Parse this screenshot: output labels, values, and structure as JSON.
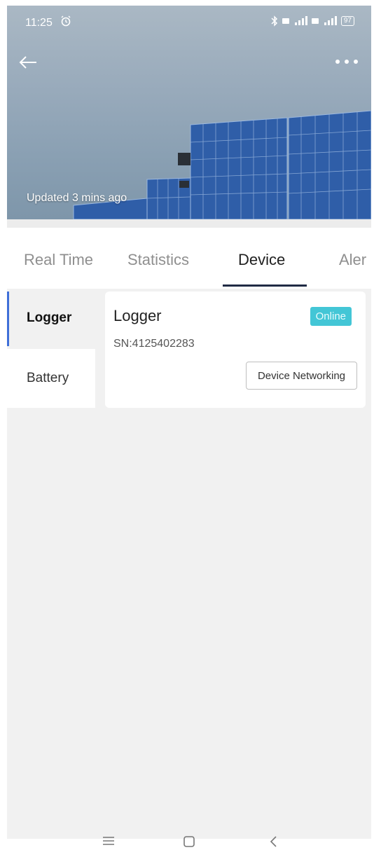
{
  "status_bar": {
    "time": "11:25",
    "battery": "97"
  },
  "header": {
    "updated_text": "Updated 3 mins ago"
  },
  "tabs": [
    {
      "label": "Real Time"
    },
    {
      "label": "Statistics"
    },
    {
      "label": "Device",
      "active": true
    },
    {
      "label": "Aler"
    }
  ],
  "sidebar": {
    "items": [
      {
        "label": "Logger",
        "active": true
      },
      {
        "label": "Battery",
        "active": false
      }
    ]
  },
  "device_card": {
    "title": "Logger",
    "sn": "SN:4125402283",
    "status": "Online",
    "action_label": "Device Networking"
  },
  "colors": {
    "accent": "#3f6fd8",
    "online_badge": "#43c6d6",
    "tab_indicator": "#1f2a44"
  },
  "icons": {
    "back": "back-arrow-icon",
    "more": "more-icon",
    "alarm": "alarm-clock-icon",
    "bluetooth": "bluetooth-icon",
    "nav_menu": "menu-icon",
    "nav_home": "home-icon",
    "nav_back": "back-chevron-icon"
  }
}
